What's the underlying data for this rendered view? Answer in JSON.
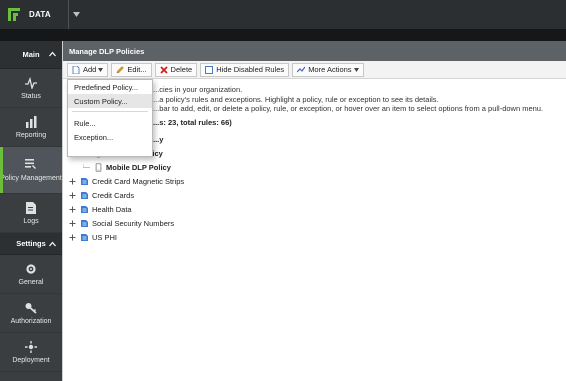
{
  "topbar": {
    "logo_text": "DATA"
  },
  "sidebar": {
    "main_header": "Main",
    "items": [
      {
        "label": "Status",
        "icon": "pulse-icon"
      },
      {
        "label": "Reporting",
        "icon": "bar-chart-icon"
      },
      {
        "label": "Policy Management",
        "icon": "policy-list-icon"
      },
      {
        "label": "Logs",
        "icon": "document-icon"
      }
    ],
    "settings_header": "Settings",
    "settings_items": [
      {
        "label": "General",
        "icon": "gear-icon"
      },
      {
        "label": "Authorization",
        "icon": "key-icon"
      },
      {
        "label": "Deployment",
        "icon": "deployment-icon"
      }
    ]
  },
  "panel": {
    "title": "Manage DLP Policies",
    "toolbar": {
      "add": "Add",
      "edit": "Edit...",
      "delete": "Delete",
      "hide_disabled": "Hide Disabled Rules",
      "more_actions": "More Actions"
    },
    "info_lines": [
      "...cies in your organization.",
      "...a policy's rules and exceptions. Highlight a policy, rule or exception to see its details.",
      "...bar to add, edit, or delete a policy, rule, or exception, or hover over an item to select options from a pull-down menu."
    ],
    "summary": "...s: 23, total rules: 66)",
    "tree": {
      "partial_parent": "...y",
      "children": [
        "Web DLP Policy",
        "Mobile DLP Policy"
      ],
      "policies": [
        "Credit Card Magnetic Strips",
        "Credit Cards",
        "Health Data",
        "Social Security Numbers",
        "US PHI"
      ]
    }
  },
  "add_menu": {
    "items": [
      "Predefined Policy...",
      "Custom Policy..."
    ],
    "items2": [
      "Rule...",
      "Exception..."
    ]
  },
  "colors": {
    "accent_green": "#6cbf3b",
    "topbar": "#2b2f31",
    "sidebar": "#3a3e41",
    "panel_header": "#5d6266"
  }
}
